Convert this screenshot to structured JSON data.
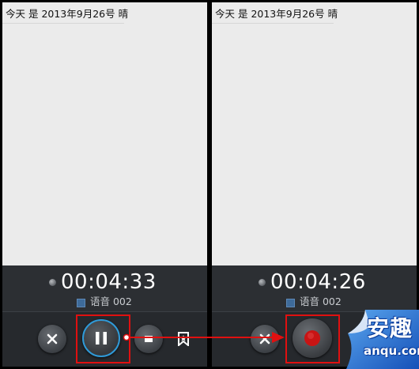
{
  "status_text": "今天 是 2013年9月26号 晴",
  "accent_color": "#2f9ad8",
  "highlight_color": "#e01010",
  "left_screen": {
    "timer": "00:04:33",
    "file_label": "语音 002",
    "state": "recording",
    "main_button": "pause",
    "icons": [
      "close-icon",
      "pause-icon",
      "stop-icon",
      "bookmark-icon"
    ]
  },
  "right_screen": {
    "timer": "00:04:26",
    "file_label": "语音 002",
    "state": "paused",
    "main_button": "record",
    "icons": [
      "close-icon",
      "record-icon"
    ]
  },
  "watermark": {
    "brand": "安趣",
    "domain": "anqu.com"
  }
}
